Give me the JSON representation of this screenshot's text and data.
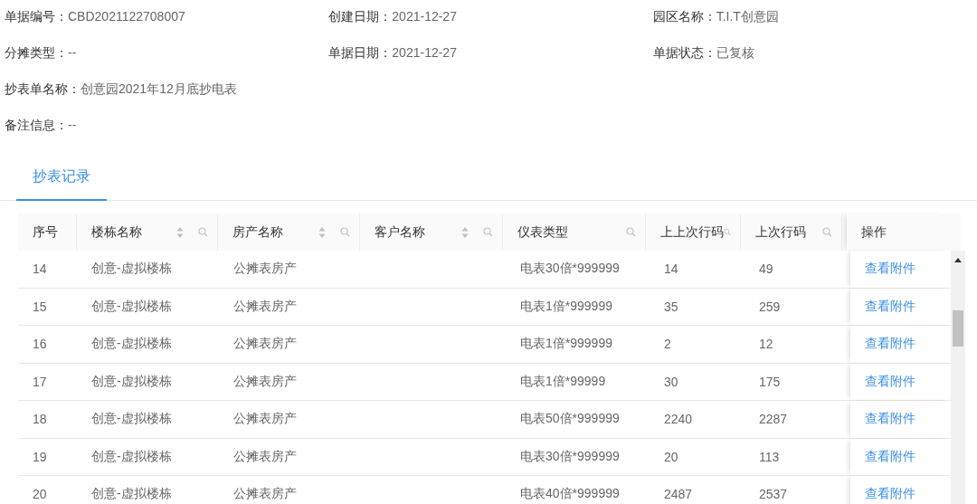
{
  "info": [
    [
      {
        "label": "单据编号：",
        "value": "CBD2021122708007"
      },
      {
        "label": "创建日期：",
        "value": "2021-12-27"
      },
      {
        "label": "园区名称：",
        "value": "T.I.T创意园"
      }
    ],
    [
      {
        "label": "分摊类型：",
        "value": "--"
      },
      {
        "label": "单据日期：",
        "value": "2021-12-27"
      },
      {
        "label": "单据状态：",
        "value": "已复核"
      }
    ],
    [
      {
        "label": "抄表单名称：",
        "value": "创意园2021年12月底抄电表"
      }
    ],
    [
      {
        "label": "备注信息：",
        "value": "--"
      }
    ]
  ],
  "tabs": [
    {
      "label": "抄表记录",
      "selected": true
    }
  ],
  "table": {
    "columns": [
      {
        "title": "序号",
        "kind": "plain"
      },
      {
        "title": "楼栋名称",
        "kind": "sort-search"
      },
      {
        "title": "房产名称",
        "kind": "sort-search"
      },
      {
        "title": "客户名称",
        "kind": "sort-search"
      },
      {
        "title": "仪表类型",
        "kind": "search"
      },
      {
        "title": "上上次行码",
        "kind": "search"
      },
      {
        "title": "上次行码",
        "kind": "search"
      },
      {
        "title": "操作",
        "kind": "plain"
      }
    ],
    "rows": [
      {
        "cells": [
          "14",
          "创意-虚拟楼栋",
          "公摊表房产",
          "",
          "电表30倍*999999",
          "14",
          "49"
        ],
        "action": "查看附件"
      },
      {
        "cells": [
          "15",
          "创意-虚拟楼栋",
          "公摊表房产",
          "",
          "电表1倍*999999",
          "35",
          "259"
        ],
        "action": "查看附件"
      },
      {
        "cells": [
          "16",
          "创意-虚拟楼栋",
          "公摊表房产",
          "",
          "电表1倍*999999",
          "2",
          "12"
        ],
        "action": "查看附件"
      },
      {
        "cells": [
          "17",
          "创意-虚拟楼栋",
          "公摊表房产",
          "",
          "电表1倍*99999",
          "30",
          "175"
        ],
        "action": "查看附件"
      },
      {
        "cells": [
          "18",
          "创意-虚拟楼栋",
          "公摊表房产",
          "",
          "电表50倍*999999",
          "2240",
          "2287"
        ],
        "action": "查看附件"
      },
      {
        "cells": [
          "19",
          "创意-虚拟楼栋",
          "公摊表房产",
          "",
          "电表30倍*999999",
          "20",
          "113"
        ],
        "action": "查看附件"
      },
      {
        "cells": [
          "20",
          "创意-虚拟楼栋",
          "公摊表房产",
          "",
          "电表40倍*999999",
          "2487",
          "2537"
        ],
        "action": "查看附件"
      }
    ]
  }
}
